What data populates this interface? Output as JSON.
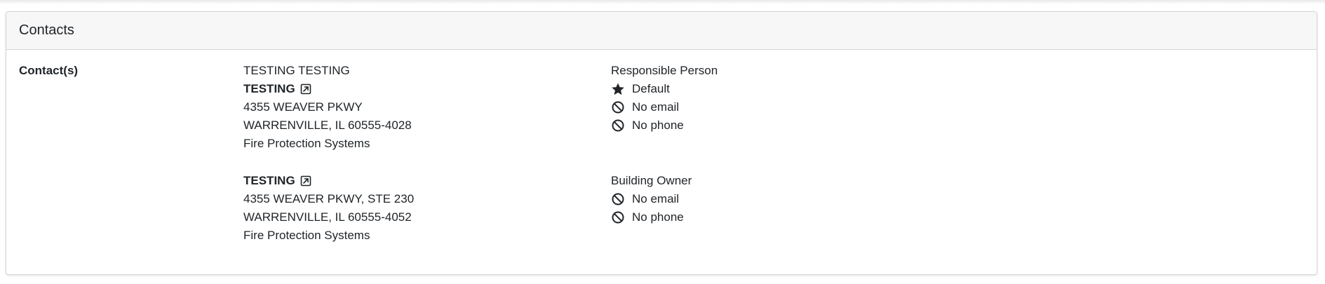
{
  "card": {
    "title": "Contacts"
  },
  "contacts_label": "Contact(s)",
  "contacts": [
    {
      "full_name": "TESTING TESTING",
      "company": "TESTING",
      "address1": "4355 WEAVER PKWY",
      "address2": "WARRENVILLE, IL 60555-4028",
      "category": "Fire Protection Systems",
      "role": "Responsible Person",
      "default_label": "Default",
      "email": "No email",
      "phone": "No phone"
    },
    {
      "company": "TESTING",
      "address1": "4355 WEAVER PKWY, STE 230",
      "address2": "WARRENVILLE, IL 60555-4052",
      "category": "Fire Protection Systems",
      "role": "Building Owner",
      "email": "No email",
      "phone": "No phone"
    }
  ],
  "icons": {
    "external_link": "external-link-icon",
    "star": "star-icon",
    "no_email": "ban-icon",
    "no_phone": "ban-icon"
  },
  "colors": {
    "text": "#212529",
    "header_bg": "#f7f7f7",
    "border": "#d6d6d6"
  }
}
